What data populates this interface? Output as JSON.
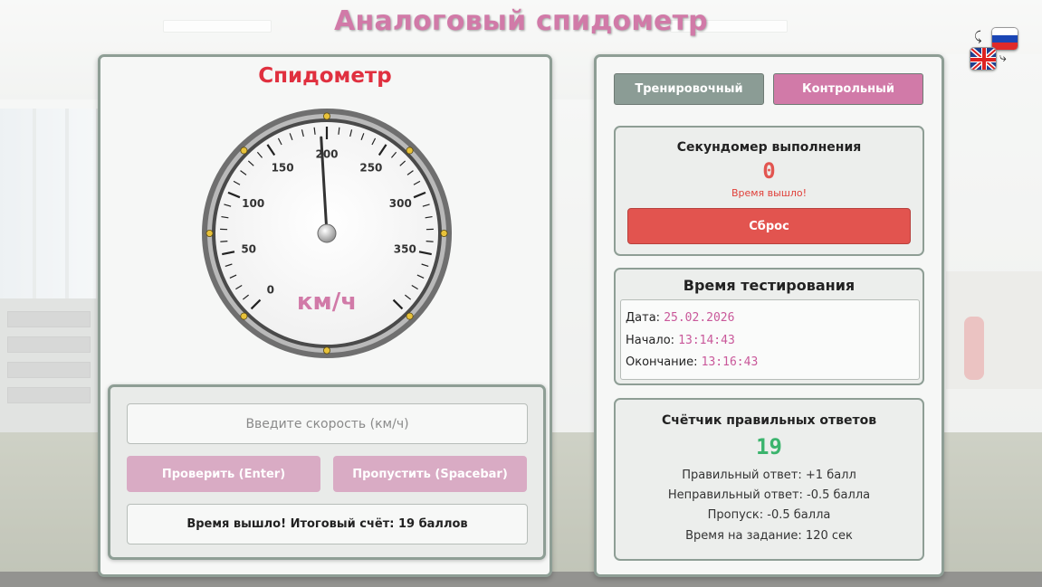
{
  "app": {
    "title": "Аналоговый спидометр"
  },
  "language": {
    "primary_flag": "ru-flag",
    "secondary_flag": "uk-flag"
  },
  "speedometer": {
    "title": "Спидометр",
    "unit_label": "км/ч",
    "tick_labels": [
      "0",
      "50",
      "100",
      "150",
      "200",
      "250",
      "300",
      "350"
    ],
    "scale_min": 0,
    "scale_max": 400,
    "needle_value": 195
  },
  "input": {
    "placeholder": "Введите скорость (км/ч)",
    "value": "",
    "check_label": "Проверить (Enter)",
    "skip_label": "Пропустить (Spacebar)",
    "result_message": "Время вышло! Итоговый счёт: 19 баллов"
  },
  "modes": {
    "training_label": "Тренировочный",
    "control_label": "Контрольный",
    "active": "control"
  },
  "stopwatch": {
    "title": "Секундомер выполнения",
    "value": "0",
    "message": "Время вышло!",
    "reset_label": "Сброс"
  },
  "test_time": {
    "title": "Время тестирования",
    "date_label": "Дата:",
    "date_value": "25.02.2026",
    "start_label": "Начало:",
    "start_value": "13:14:43",
    "end_label": "Окончание:",
    "end_value": "13:16:43"
  },
  "score": {
    "title": "Счётчик правильных ответов",
    "value": "19",
    "rules": [
      "Правильный ответ: +1 балл",
      "Неправильный ответ: -0.5 балла",
      "Пропуск: -0.5 балла",
      "Время на задание: 120 сек"
    ]
  },
  "colors": {
    "title": "#d17aa8",
    "speedo_title": "#e0303f",
    "timer": "#e25550",
    "score": "#3bb46d",
    "date_values": "#c9589a",
    "control_button": "#d17aa8",
    "training_button": "#8b9c95"
  }
}
